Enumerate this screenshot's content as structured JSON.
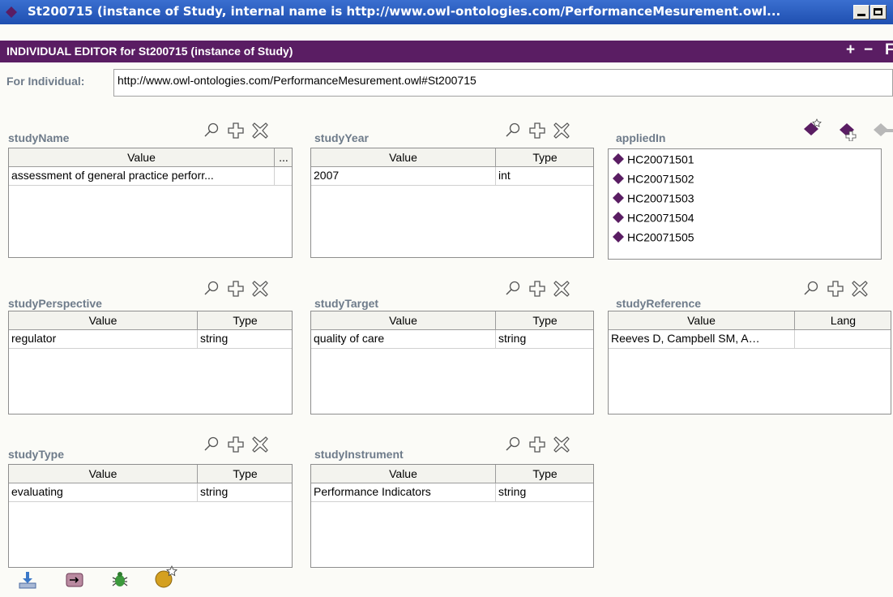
{
  "window": {
    "title": "St200715  (instance of Study, internal name is http://www.owl-ontologies.com/PerformanceMesurement.owl..."
  },
  "editor": {
    "header": "INDIVIDUAL EDITOR for St200715   (instance of Study)",
    "add_label": "+",
    "remove_label": "−",
    "extra_label": "F"
  },
  "individual": {
    "label": "For Individual:",
    "uri": "http://www.owl-ontologies.com/PerformanceMesurement.owl#St200715"
  },
  "slots": {
    "studyName": {
      "label": "studyName",
      "col_value": "Value",
      "col_more": "...",
      "rows": [
        {
          "value": "assessment of general practice perforr..."
        }
      ]
    },
    "studyYear": {
      "label": "studyYear",
      "col_value": "Value",
      "col_type": "Type",
      "rows": [
        {
          "value": "2007",
          "type": "int"
        }
      ]
    },
    "appliedIn": {
      "label": "appliedIn",
      "items": [
        "HC20071501",
        "HC20071502",
        "HC20071503",
        "HC20071504",
        "HC20071505"
      ]
    },
    "studyPerspective": {
      "label": "studyPerspective",
      "col_value": "Value",
      "col_type": "Type",
      "rows": [
        {
          "value": "regulator",
          "type": "string"
        }
      ]
    },
    "studyTarget": {
      "label": "studyTarget",
      "col_value": "Value",
      "col_type": "Type",
      "rows": [
        {
          "value": "quality of care",
          "type": "string"
        }
      ]
    },
    "studyReference": {
      "label": "studyReference",
      "col_value": "Value",
      "col_lang": "Lang",
      "rows": [
        {
          "value": "Reeves D, Campbell SM, A…",
          "lang": ""
        }
      ]
    },
    "studyType": {
      "label": "studyType",
      "col_value": "Value",
      "col_type": "Type",
      "rows": [
        {
          "value": "evaluating",
          "type": "string"
        }
      ]
    },
    "studyInstrument": {
      "label": "studyInstrument",
      "col_value": "Value",
      "col_type": "Type",
      "rows": [
        {
          "value": "Performance Indicators",
          "type": "string"
        }
      ]
    }
  },
  "icons": {
    "view": "magnifier-icon",
    "create": "plus-cross-icon",
    "delete": "delete-x-icon",
    "instance": "purple-diamond-icon"
  },
  "colors": {
    "titlebar": "#2a5fc0",
    "editor_header": "#5a1d63",
    "slot_label": "#6e7b8a",
    "instance_diamond": "#5a1d63"
  }
}
